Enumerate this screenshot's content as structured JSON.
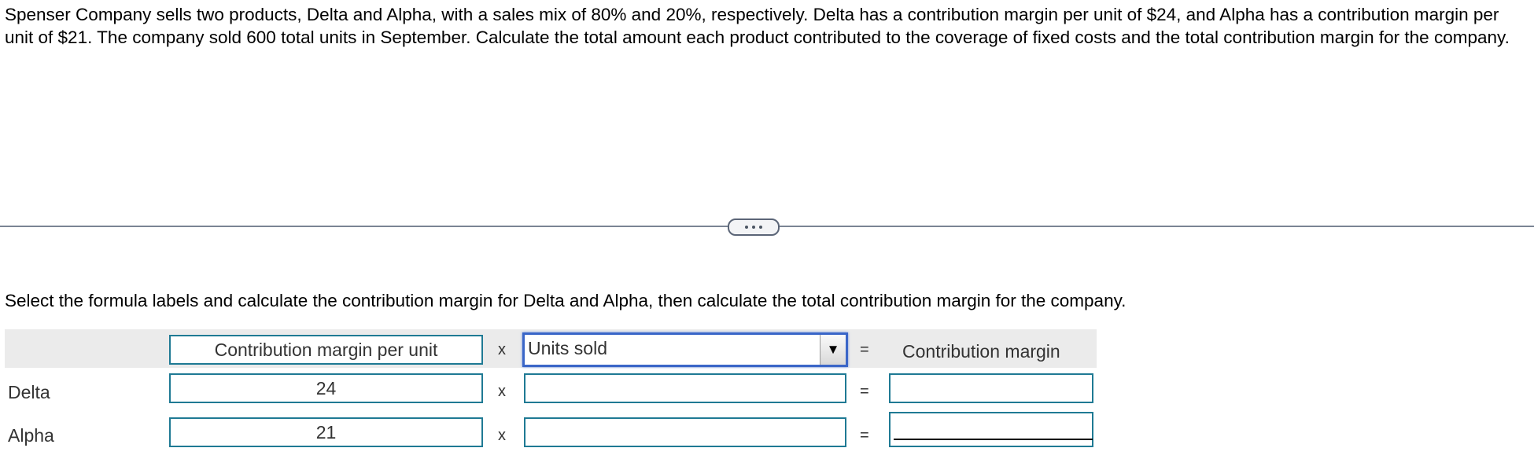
{
  "problem_text": "Spenser Company sells two products, Delta and Alpha, with a sales mix of 80% and 20%, respectively. Delta has a contribution margin per unit of $24, and Alpha has a contribution margin per unit of $21. The company sold 600 total units in September. Calculate the total amount each product contributed to the coverage of fixed costs and the total contribution margin for the company.",
  "expand_button": {
    "icon": "ellipsis-icon"
  },
  "instructions": "Select the formula labels and calculate the contribution margin for Delta and Alpha, then calculate the total contribution margin for the company.",
  "table": {
    "header": {
      "col1": "Contribution margin per unit",
      "operator1": "x",
      "col2_select_value": "Units sold",
      "operator2": "=",
      "col3": "Contribution margin"
    },
    "rows": [
      {
        "label": "Delta",
        "cm_per_unit": "24",
        "operator1": "x",
        "units_sold": "",
        "operator2": "=",
        "contribution_margin": ""
      },
      {
        "label": "Alpha",
        "cm_per_unit": "21",
        "operator1": "x",
        "units_sold": "",
        "operator2": "=",
        "contribution_margin": ""
      }
    ]
  },
  "colors": {
    "input_border": "#1f7a94",
    "select_focus": "#3a66c8",
    "header_band": "#ebebeb"
  }
}
